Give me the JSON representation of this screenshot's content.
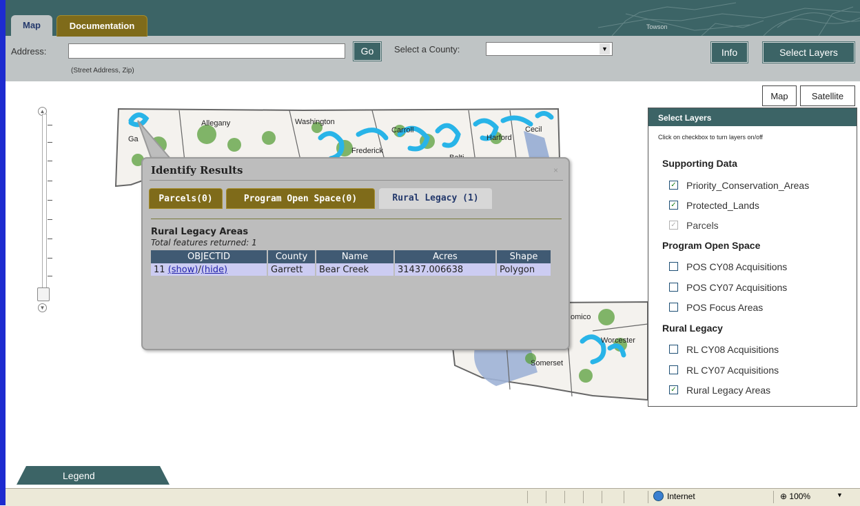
{
  "tabs": {
    "map": "Map",
    "documentation": "Documentation"
  },
  "header": {
    "address_label": "Address:",
    "address_value": "",
    "address_hint": "(Street Address, Zip)",
    "go_label": "Go",
    "county_label": "Select a County:",
    "county_value": "",
    "info_label": "Info",
    "select_layers_label": "Select Layers",
    "map_watermark_town": "Towson"
  },
  "map_controls": {
    "map_label": "Map",
    "satellite_label": "Satellite"
  },
  "map_labels": [
    "Allegany",
    "Washington",
    "Carroll",
    "Harford",
    "Cecil",
    "Frederick",
    "Balti",
    "Somerset",
    "Worcester",
    "omico",
    "Ga"
  ],
  "identify": {
    "title": "Identify Results",
    "close": "×",
    "tabs": [
      "Parcels(0)",
      "Program Open Space(0)",
      "Rural Legacy (1)"
    ],
    "section_title": "Rural Legacy Areas",
    "section_subtitle": "Total features returned: 1",
    "columns": [
      "OBJECTID",
      "County",
      "Name",
      "Acres",
      "Shape"
    ],
    "row": {
      "objectid": "11",
      "show": "(show)",
      "slash": "/",
      "hide": "(hide)",
      "county": "Garrett",
      "name": "Bear Creek",
      "acres": "31437.006638",
      "shape": "Polygon"
    }
  },
  "layers": {
    "header": "Select Layers",
    "hint": "Click on checkbox to turn layers on/off",
    "groups": [
      {
        "title": "Supporting Data",
        "items": [
          {
            "label": "Priority_Conservation_Areas",
            "checked": true
          },
          {
            "label": "Protected_Lands",
            "checked": true
          },
          {
            "label": "Parcels",
            "checked": true,
            "disabled": true
          }
        ]
      },
      {
        "title": "Program Open Space",
        "items": [
          {
            "label": "POS CY08 Acquisitions",
            "checked": false
          },
          {
            "label": "POS CY07 Acquisitions",
            "checked": false
          },
          {
            "label": "POS Focus Areas",
            "checked": false
          }
        ]
      },
      {
        "title": "Rural Legacy",
        "items": [
          {
            "label": "RL CY08 Acquisitions",
            "checked": false
          },
          {
            "label": "RL CY07 Acquisitions",
            "checked": false
          },
          {
            "label": "Rural Legacy Areas",
            "checked": true
          }
        ]
      }
    ]
  },
  "legend_label": "Legend",
  "statusbar": {
    "zone": "Internet",
    "zoom": "100%"
  },
  "icons": {
    "check": "✓",
    "zoom_in": "⊕",
    "dropdown": "▼"
  }
}
